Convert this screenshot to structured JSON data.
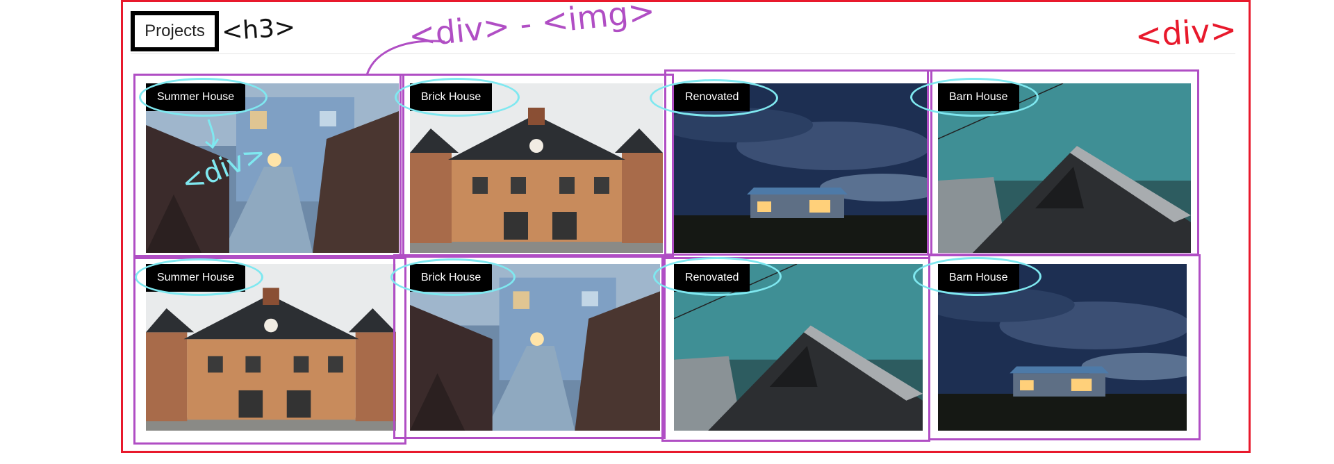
{
  "section": {
    "heading": "Projects"
  },
  "projects": [
    {
      "label": "Summer House",
      "scene": "summer-house"
    },
    {
      "label": "Brick House",
      "scene": "brick-house"
    },
    {
      "label": "Renovated",
      "scene": "renovated"
    },
    {
      "label": "Barn House",
      "scene": "barn-house"
    },
    {
      "label": "Summer House",
      "scene": "brick-house"
    },
    {
      "label": "Brick House",
      "scene": "summer-house"
    },
    {
      "label": "Renovated",
      "scene": "barn-house"
    },
    {
      "label": "Barn House",
      "scene": "renovated"
    }
  ],
  "annotations": {
    "h3_tag": "<h3>",
    "div_img_tag": "<div> - <img>",
    "outer_div_tag": "<div>",
    "inner_div_tag": "<div>"
  },
  "colors": {
    "outer_frame": "#e8192c",
    "card_outline": "#b04ec4",
    "label_ring": "#7fe8f0",
    "label_bg": "#000000",
    "label_text": "#ffffff"
  }
}
